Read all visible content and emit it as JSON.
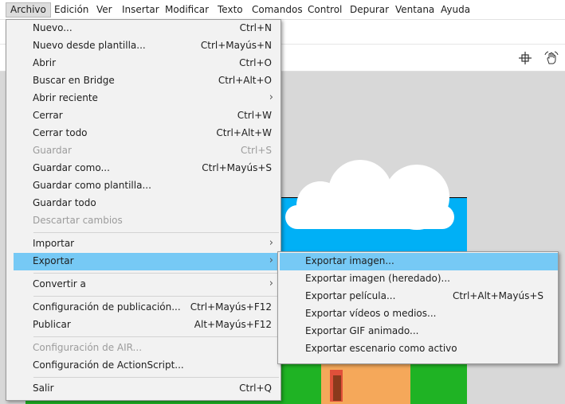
{
  "menubar": {
    "items": [
      "Archivo",
      "Edición",
      "Ver",
      "Insertar",
      "Modificar",
      "Texto",
      "Comandos",
      "Control",
      "Depurar",
      "Ventana",
      "Ayuda"
    ],
    "active": "Archivo"
  },
  "toolbar": {
    "icons": [
      "crosshair-icon",
      "hand-rotate-icon"
    ]
  },
  "file_menu": {
    "items": [
      {
        "label": "Nuevo...",
        "shortcut": "Ctrl+N"
      },
      {
        "label": "Nuevo desde plantilla...",
        "shortcut": "Ctrl+Mayús+N"
      },
      {
        "label": "Abrir",
        "shortcut": "Ctrl+O"
      },
      {
        "label": "Buscar en Bridge",
        "shortcut": "Ctrl+Alt+O"
      },
      {
        "label": "Abrir reciente",
        "submenu": true
      },
      {
        "label": "Cerrar",
        "shortcut": "Ctrl+W"
      },
      {
        "label": "Cerrar todo",
        "shortcut": "Ctrl+Alt+W"
      },
      {
        "label": "Guardar",
        "shortcut": "Ctrl+S",
        "disabled": true
      },
      {
        "label": "Guardar como...",
        "shortcut": "Ctrl+Mayús+S"
      },
      {
        "label": "Guardar como plantilla..."
      },
      {
        "label": "Guardar todo"
      },
      {
        "label": "Descartar cambios",
        "disabled": true
      },
      {
        "label": "Importar",
        "submenu": true
      },
      {
        "label": "Exportar",
        "submenu": true,
        "highlighted": true
      },
      {
        "label": "Convertir a",
        "submenu": true
      },
      {
        "label": "Configuración de publicación...",
        "shortcut": "Ctrl+Mayús+F12"
      },
      {
        "label": "Publicar",
        "shortcut": "Alt+Mayús+F12"
      },
      {
        "label": "Configuración de AIR...",
        "disabled": true
      },
      {
        "label": "Configuración de ActionScript..."
      },
      {
        "label": "Salir",
        "shortcut": "Ctrl+Q"
      }
    ]
  },
  "export_menu": {
    "items": [
      {
        "label": "Exportar imagen...",
        "highlighted": true
      },
      {
        "label": "Exportar imagen (heredado)..."
      },
      {
        "label": "Exportar película...",
        "shortcut": "Ctrl+Alt+Mayús+S"
      },
      {
        "label": "Exportar vídeos o medios..."
      },
      {
        "label": "Exportar GIF animado..."
      },
      {
        "label": "Exportar escenario como activo"
      }
    ]
  },
  "colors": {
    "highlight": "#76c9f5",
    "sky": "#00b0f6",
    "grass": "#1fb324"
  }
}
